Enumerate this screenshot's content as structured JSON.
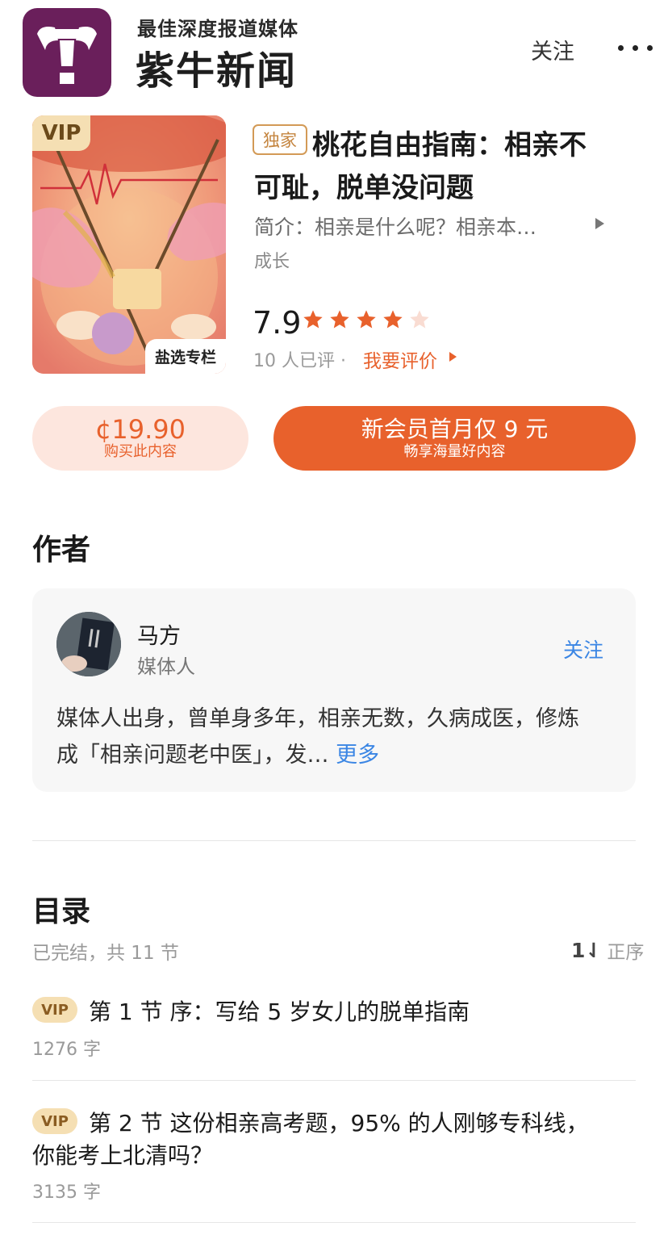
{
  "header": {
    "slogan": "最佳深度报道媒体",
    "brand": "紫牛新闻",
    "follow_label": "关注"
  },
  "book": {
    "cover_vip": "VIP",
    "cover_tag": "盐选专栏",
    "exclusive": "独家",
    "title_line1": "桃花自由指南：相亲不",
    "title_line2": "可耻，脱单没问题",
    "intro": "简介：相亲是什么呢？相亲本…",
    "category": "成长",
    "rating": "7.9",
    "stars": 4,
    "rating_count": "10 人已评 ·",
    "rate_label": "我要评价"
  },
  "buttons": {
    "price": "¢19.90",
    "buy_label": "购买此内容",
    "member_main": "新会员首月仅 9 元",
    "member_sub": "畅享海量好内容"
  },
  "author": {
    "section_title": "作者",
    "name": "马方",
    "role": "媒体人",
    "follow_label": "关注",
    "bio_line1": "媒体人出身，曾单身多年，相亲无数，久病成医，修炼",
    "bio_line2": "成「相亲问题老中医」，发…",
    "more_label": "更多"
  },
  "toc": {
    "section_title": "目录",
    "status": "已完结，共 11 节",
    "sort_icon": "1⇃",
    "sort_label": "正序",
    "chapters": [
      {
        "badge": "VIP",
        "title_line1": "第 1 节 序：写给 5 岁女儿的脱单指南",
        "title_line2": "",
        "words": "1276 字"
      },
      {
        "badge": "VIP",
        "title_line1": "第 2 节 这份相亲高考题，95% 的人刚够专科线，",
        "title_line2": "你能考上北清吗？",
        "words": "3135 字"
      }
    ]
  },
  "colors": {
    "accent": "#e8612c",
    "link": "#3b86e4",
    "brand_purple": "#6a1f5b",
    "vip_gold": "#f5dfb3"
  }
}
